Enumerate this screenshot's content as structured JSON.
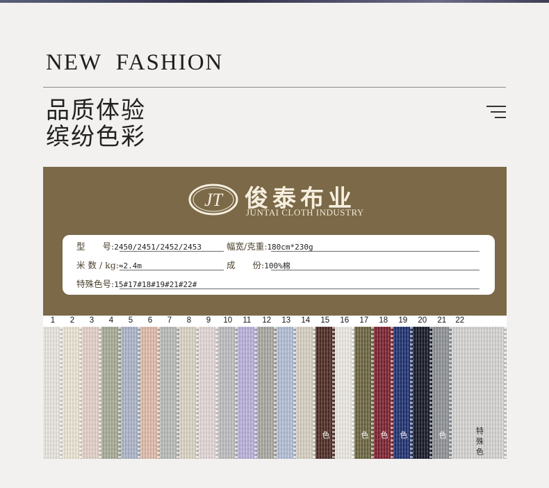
{
  "header": {
    "title": "NEW  FASHION",
    "subtitle_line1": "品质体验",
    "subtitle_line2": "缤纷色彩"
  },
  "menu": {
    "icon": "menu-icon"
  },
  "brand": {
    "logo_letters": "JT",
    "name_cn": "俊泰布业",
    "name_en": "JUNTAI CLOTH INDUSTRY"
  },
  "specs": {
    "model_label": "型　　号:",
    "model_value": "2450/2451/2452/2453",
    "width_weight_label": "幅宽/克重:",
    "width_weight_value": "180cm*230g",
    "meter_label": "米 数 / kg:",
    "meter_value": "≈2.4m",
    "composition_label": "成　　份:",
    "composition_value": "100%棉",
    "special_label": "特殊色号:",
    "special_value": "15#17#18#19#21#22#"
  },
  "swatch_numbers": [
    "1",
    "2",
    "3",
    "4",
    "5",
    "6",
    "7",
    "8",
    "9",
    "10",
    "11",
    "12",
    "13",
    "14",
    "15",
    "16",
    "17",
    "18",
    "19",
    "20",
    "21",
    "22"
  ],
  "swatch_colors": [
    "#e8e4de",
    "#e9e3d3",
    "#e3cfc8",
    "#a5aa95",
    "#aab3c6",
    "#ddbaa9",
    "#b8bab6",
    "#d9d3c2",
    "#e2d6d5",
    "#bcbcbf",
    "#b9b0d9",
    "#a9a6a1",
    "#b2bdd4",
    "#d6cfc0",
    "#4b2a21",
    "#ebe8e3",
    "#69633d",
    "#7b1f2d",
    "#1d2f6e",
    "#141826",
    "#8d9094",
    "#d5d3d1"
  ],
  "special_text": "特殊色"
}
